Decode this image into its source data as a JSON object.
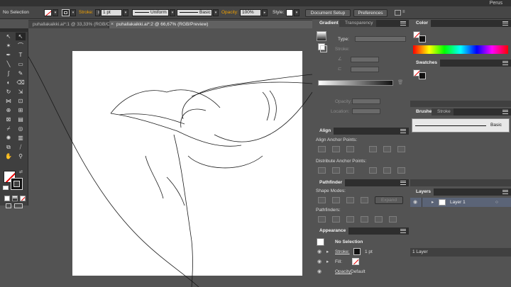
{
  "workspace": "Perus",
  "control_bar": {
    "selection_label": "No Selection",
    "stroke_label": "Stroke:",
    "stroke_weight": "1 pt",
    "profile_value": "Uniform",
    "brush_value": "Basic",
    "opacity_label": "Opacity:",
    "opacity_value": "100%",
    "style_label": "Style:",
    "document_setup_button": "Document Setup",
    "preferences_button": "Preferences"
  },
  "tabs": [
    {
      "label": "puhallakaikki.ai*:1 @ 33,33% (RGB/Outline)",
      "active": false
    },
    {
      "label": "puhallakaikki.ai*:2 @ 66,67% (RGB/Preview)",
      "active": true
    }
  ],
  "gradient_panel": {
    "tab_gradient": "Gradient",
    "tab_transparency": "Transparency",
    "type_label": "Type:",
    "stroke_label": "Stroke:",
    "opacity_label": "Opacity:",
    "location_label": "Location:"
  },
  "align_panel": {
    "title": "Align",
    "align_anchor_points": "Align Anchor Points:",
    "distribute_anchor_points": "Distribute Anchor Points:"
  },
  "pathfinder_panel": {
    "title": "Pathfinder",
    "shape_modes": "Shape Modes:",
    "expand_button": "Expand",
    "pathfinders": "Pathfinders:"
  },
  "appearance_panel": {
    "title": "Appearance",
    "selection": "No Selection",
    "stroke_label": "Stroke:",
    "stroke_value": "1 pt",
    "fill_label": "Fill:",
    "opacity_label": "Opacity:",
    "opacity_value": "Default"
  },
  "color_panel": {
    "title": "Color"
  },
  "swatches_panel": {
    "title": "Swatches"
  },
  "brushes_panel": {
    "tab_brushes": "Brushes",
    "tab_stroke": "Stroke",
    "brush_name": "Basic"
  },
  "layers_panel": {
    "title": "Layers",
    "layer_name": "Layer 1",
    "layer_count": "1 Layer"
  }
}
